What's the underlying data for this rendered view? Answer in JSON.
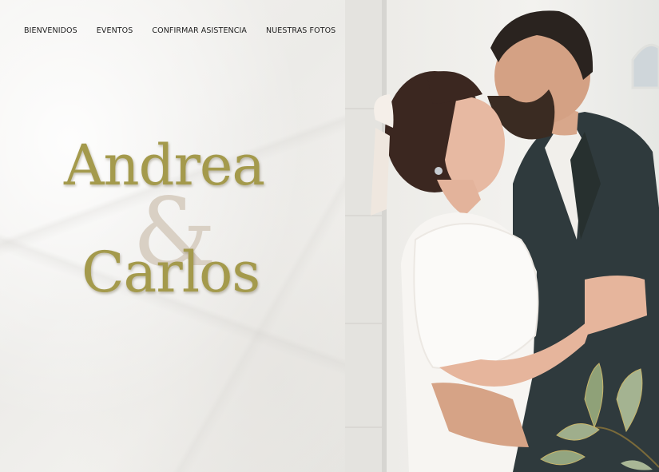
{
  "nav": {
    "items": [
      "BIENVENIDOS",
      "EVENTOS",
      "CONFIRMAR ASISTENCIA",
      "NUESTRAS FOTOS"
    ]
  },
  "hero": {
    "name_1": "Andrea",
    "ampersand": "&",
    "name_2": "Carlos"
  },
  "colors": {
    "gold": "#a49a4c",
    "ampersand": "#d9d0c4",
    "paper": "#efeeeb",
    "suit": "#2f3a3d"
  },
  "photo": {
    "icon": "couple-photo"
  }
}
